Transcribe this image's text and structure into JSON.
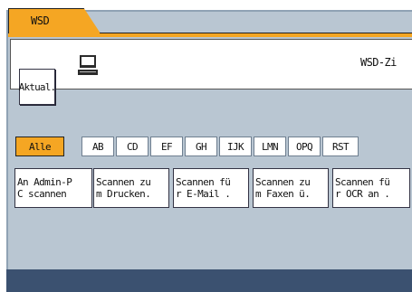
{
  "tab": {
    "label": "WSD"
  },
  "toolbar": {
    "refresh_label": "Aktual.",
    "destination_title": "WSD-Zi"
  },
  "filters": [
    {
      "label": "Alle",
      "active": true
    },
    {
      "label": "AB",
      "active": false
    },
    {
      "label": "CD",
      "active": false
    },
    {
      "label": "EF",
      "active": false
    },
    {
      "label": "GH",
      "active": false
    },
    {
      "label": "IJK",
      "active": false
    },
    {
      "label": "LMN",
      "active": false
    },
    {
      "label": "OPQ",
      "active": false
    },
    {
      "label": "RST",
      "active": false
    }
  ],
  "destinations": [
    {
      "label": "An Admin-P\nC scannen"
    },
    {
      "label": "Scannen zu\nm Drucken."
    },
    {
      "label": "Scannen fü\nr E-Mail ."
    },
    {
      "label": "Scannen zu\nm Faxen ü."
    },
    {
      "label": "Scannen fü\nr OCR an ."
    }
  ],
  "colors": {
    "accent": "#f5a623",
    "panel": "#b9c6d2",
    "footer": "#3b5170"
  },
  "icons": {
    "device": "computer-icon"
  }
}
